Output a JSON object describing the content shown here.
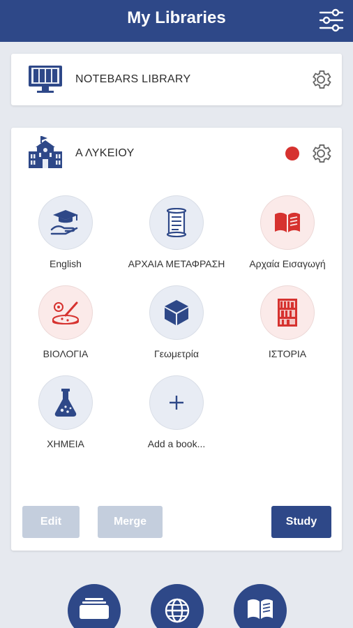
{
  "header": {
    "title": "My Libraries",
    "filter_icon": "sliders-icon"
  },
  "libraries": [
    {
      "title": "NOTEBARS LIBRARY",
      "icon": "library-shelves-icon",
      "settings_icon": "gear-icon"
    },
    {
      "title": "Α ΛΥΚΕΙΟΥ",
      "icon": "school-building-icon",
      "settings_icon": "gear-icon",
      "status_color": "#d6322f",
      "books": [
        {
          "label": "English",
          "icon": "graduation-hand-icon",
          "tone": "blue"
        },
        {
          "label": "ΑΡΧΑΙΑ ΜΕΤΑΦΡΑΣΗ",
          "icon": "scroll-icon",
          "tone": "blue"
        },
        {
          "label": "Αρχαία Εισαγωγή",
          "icon": "open-book-icon",
          "tone": "red"
        },
        {
          "label": "ΒΙΟΛΟΓΙΑ",
          "icon": "petri-dish-icon",
          "tone": "red"
        },
        {
          "label": "Γεωμετρία",
          "icon": "cube-icon",
          "tone": "blue"
        },
        {
          "label": "ΙΣΤΟΡΙΑ",
          "icon": "bookshelf-icon",
          "tone": "red"
        },
        {
          "label": "ΧΗΜΕΙΑ",
          "icon": "flask-icon",
          "tone": "blue"
        },
        {
          "label": "Add a book...",
          "icon": "plus-icon",
          "tone": "blue"
        }
      ],
      "actions": {
        "edit": "Edit",
        "merge": "Merge",
        "study": "Study"
      }
    }
  ],
  "bottom_nav": [
    {
      "icon": "folder-stack-icon"
    },
    {
      "icon": "globe-icon"
    },
    {
      "icon": "reading-book-icon"
    }
  ],
  "colors": {
    "primary": "#2e4888",
    "accent_red": "#d6322f",
    "disabled": "#c4cedd",
    "background": "#e6e9ef"
  }
}
